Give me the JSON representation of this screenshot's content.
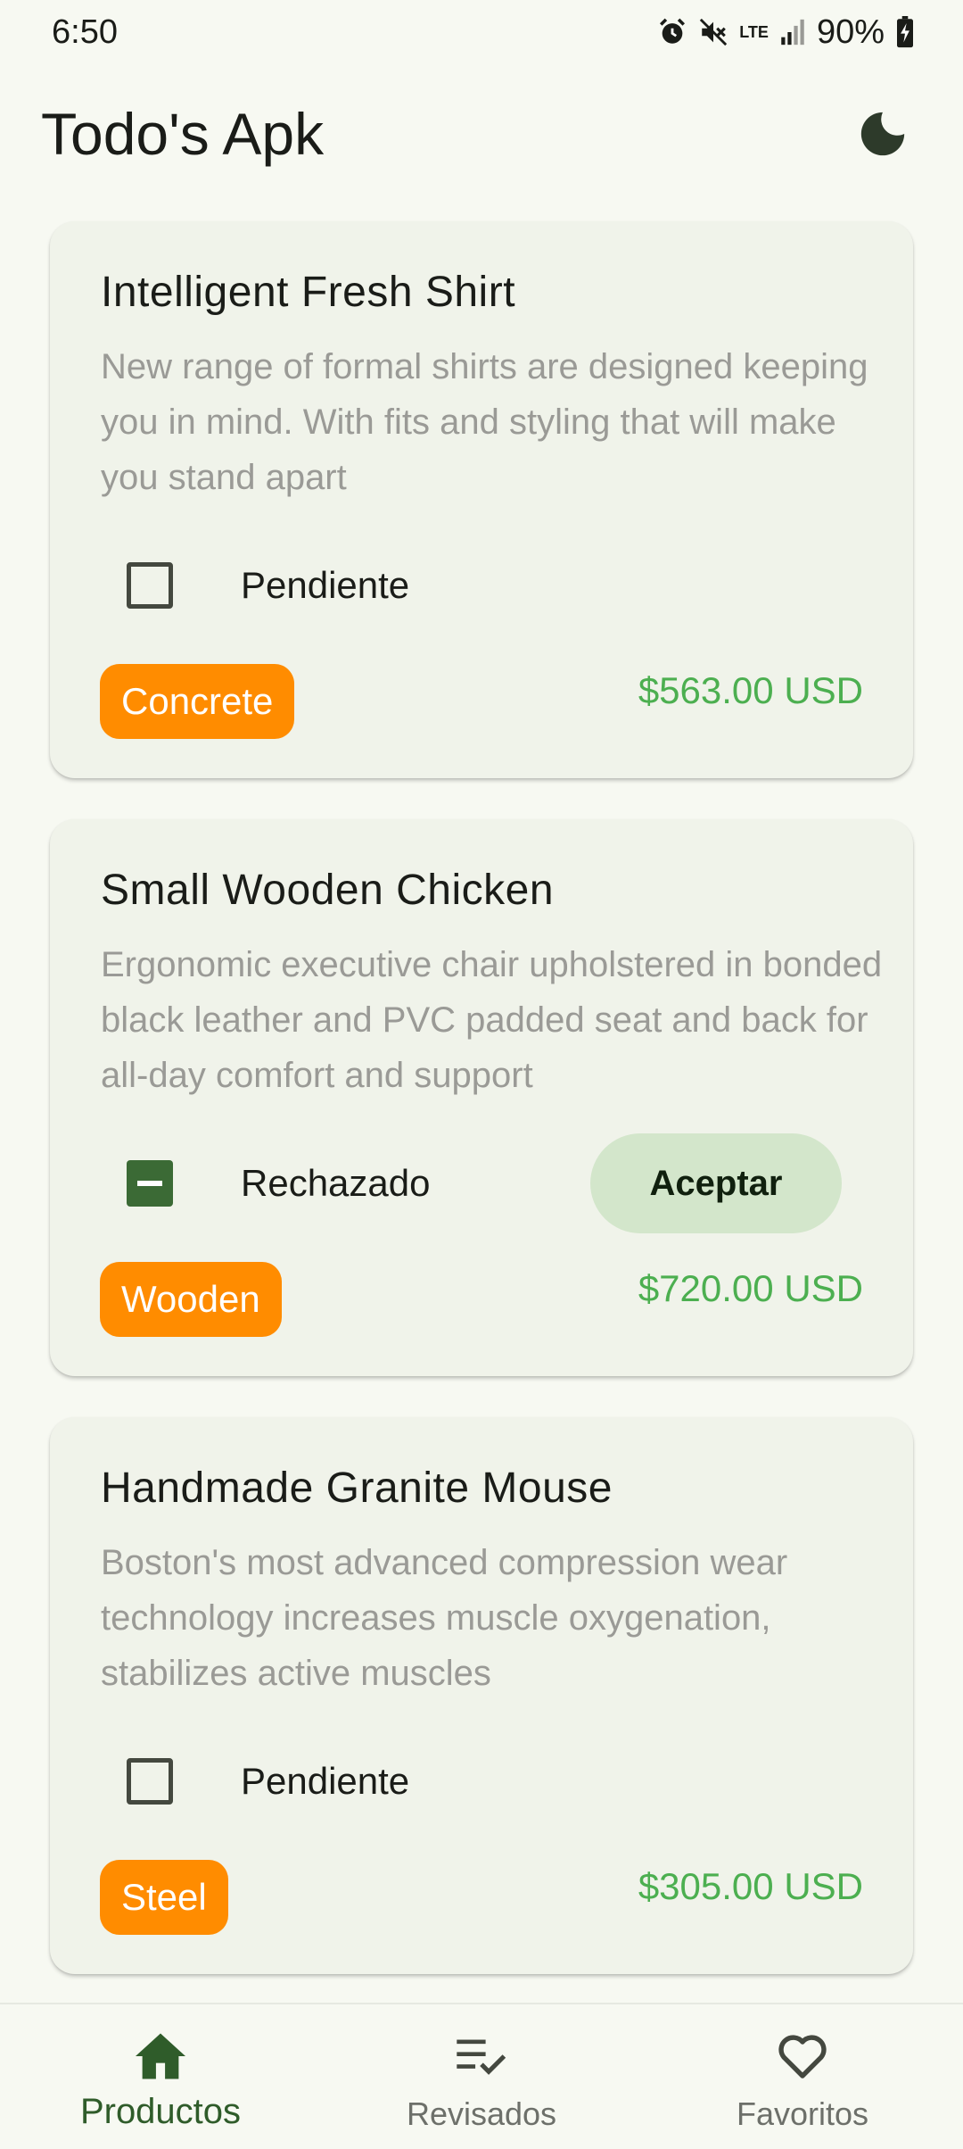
{
  "status_bar": {
    "time": "6:50",
    "network_label": "LTE",
    "battery": "90%",
    "icons": [
      "alarm-icon",
      "mute-icon",
      "lte-icon",
      "signal-icon",
      "battery-icon"
    ]
  },
  "app_bar": {
    "title": "Todo's Apk",
    "theme_toggle_icon": "moon-icon"
  },
  "products": [
    {
      "title": "Intelligent Fresh Shirt",
      "description": "New range of formal shirts are designed keeping you in mind. With fits and styling that will make you stand apart",
      "status": "Pendiente",
      "checkbox_state": "unchecked",
      "chip": "Concrete",
      "price": "$563.00 USD"
    },
    {
      "title": "Small Wooden Chicken",
      "description": "Ergonomic executive chair upholstered in bonded black leather and PVC padded seat and back for all-day comfort and support",
      "status": "Rechazado",
      "checkbox_state": "indeterminate",
      "action_label": "Aceptar",
      "chip": "Wooden",
      "price": "$720.00 USD"
    },
    {
      "title": "Handmade Granite Mouse",
      "description": "Boston's most advanced compression wear technology increases muscle oxygenation, stabilizes active muscles",
      "status": "Pendiente",
      "checkbox_state": "unchecked",
      "chip": "Steel",
      "price": "$305.00 USD"
    }
  ],
  "bottom_nav": {
    "items": [
      {
        "label": "Productos",
        "icon": "home-icon",
        "active": true
      },
      {
        "label": "Revisados",
        "icon": "checklist-icon",
        "active": false
      },
      {
        "label": "Favoritos",
        "icon": "heart-icon",
        "active": false
      }
    ]
  },
  "colors": {
    "background": "#f7f9f2",
    "card": "#f0f3ea",
    "chip": "#ff8c00",
    "price": "#4caf50",
    "primary": "#3b6a35",
    "accept_button": "#d3e6cb"
  }
}
